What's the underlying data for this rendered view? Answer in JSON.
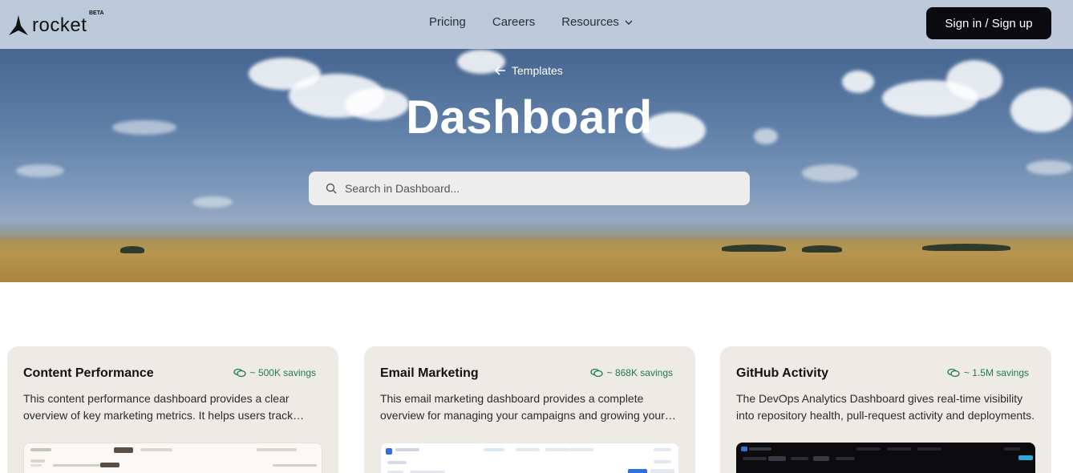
{
  "brand": {
    "name": "rocket",
    "badge": "BETA"
  },
  "nav": {
    "links": [
      "Pricing",
      "Careers",
      "Resources"
    ],
    "signin_label": "Sign in / Sign up"
  },
  "hero": {
    "back_label": "Templates",
    "title": "Dashboard",
    "search_placeholder": "Search in Dashboard..."
  },
  "cards": [
    {
      "title": "Content Performance",
      "savings": "~ 500K savings",
      "description": "This content performance dashboard provides a clear overview of key marketing metrics. It helps users track performance and engagement."
    },
    {
      "title": "Email Marketing",
      "savings": "~ 868K savings",
      "description": "This email marketing dashboard provides a complete overview for managing your campaigns and growing your audience."
    },
    {
      "title": "GitHub Activity",
      "savings": "~ 1.5M savings",
      "description": "The DevOps Analytics Dashboard gives real-time visibility into repository health, pull-request activity and deployments."
    }
  ],
  "colors": {
    "accent_dark": "#0b0b0f",
    "savings_green": "#1f7a4f",
    "card_bg": "#eeebe7"
  },
  "icons": [
    "rocket-logo-icon",
    "chevron-down-icon",
    "arrow-left-icon",
    "search-icon",
    "savings-coins-icon"
  ]
}
